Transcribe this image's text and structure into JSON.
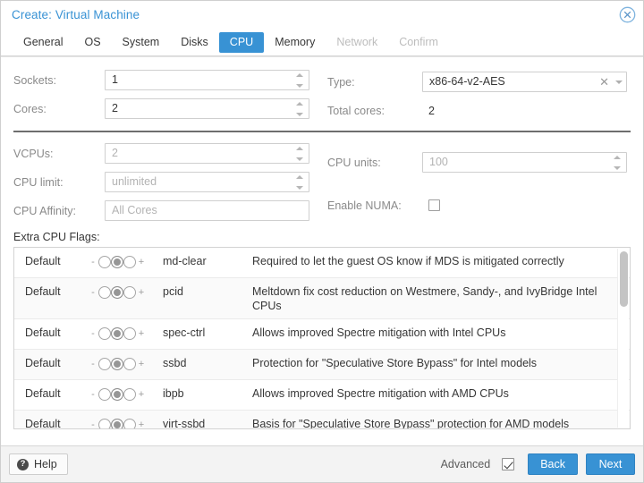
{
  "window": {
    "title": "Create: Virtual Machine",
    "close_icon": "close-circle-icon",
    "accent_color": "#3892d4"
  },
  "tabs": [
    {
      "label": "General",
      "state": "enabled"
    },
    {
      "label": "OS",
      "state": "enabled"
    },
    {
      "label": "System",
      "state": "enabled"
    },
    {
      "label": "Disks",
      "state": "enabled"
    },
    {
      "label": "CPU",
      "state": "active"
    },
    {
      "label": "Memory",
      "state": "enabled"
    },
    {
      "label": "Network",
      "state": "disabled"
    },
    {
      "label": "Confirm",
      "state": "disabled"
    }
  ],
  "form": {
    "sockets": {
      "label": "Sockets:",
      "value": "1"
    },
    "cores": {
      "label": "Cores:",
      "value": "2"
    },
    "type": {
      "label": "Type:",
      "value": "x86-64-v2-AES",
      "clear_icon": "clear-x-icon",
      "arrow_icon": "chevron-down-icon"
    },
    "total_cores": {
      "label": "Total cores:",
      "value": "2"
    },
    "vcpus": {
      "label": "VCPUs:",
      "value": "2"
    },
    "cpu_units": {
      "label": "CPU units:",
      "value": "100"
    },
    "cpu_limit": {
      "label": "CPU limit:",
      "placeholder": "unlimited"
    },
    "enable_numa": {
      "label": "Enable NUMA:",
      "checked": false
    },
    "cpu_affinity": {
      "label": "CPU Affinity:",
      "placeholder": "All Cores"
    }
  },
  "flags_section": {
    "label": "Extra CPU Flags:",
    "default_label": "Default",
    "minus_label": "-",
    "plus_label": "+",
    "rows": [
      {
        "state": "Default",
        "selected_index": 1,
        "name": "md-clear",
        "description": "Required to let the guest OS know if MDS is mitigated correctly"
      },
      {
        "state": "Default",
        "selected_index": 1,
        "name": "pcid",
        "description": "Meltdown fix cost reduction on Westmere, Sandy-, and IvyBridge Intel CPUs"
      },
      {
        "state": "Default",
        "selected_index": 1,
        "name": "spec-ctrl",
        "description": "Allows improved Spectre mitigation with Intel CPUs"
      },
      {
        "state": "Default",
        "selected_index": 1,
        "name": "ssbd",
        "description": "Protection for \"Speculative Store Bypass\" for Intel models"
      },
      {
        "state": "Default",
        "selected_index": 1,
        "name": "ibpb",
        "description": "Allows improved Spectre mitigation with AMD CPUs"
      },
      {
        "state": "Default",
        "selected_index": 1,
        "name": "virt-ssbd",
        "description": "Basis for \"Speculative Store Bypass\" protection for AMD models"
      }
    ]
  },
  "footer": {
    "help_label": "Help",
    "help_icon": "question-mark-icon",
    "advanced_label": "Advanced",
    "advanced_checked": true,
    "back_label": "Back",
    "next_label": "Next"
  }
}
